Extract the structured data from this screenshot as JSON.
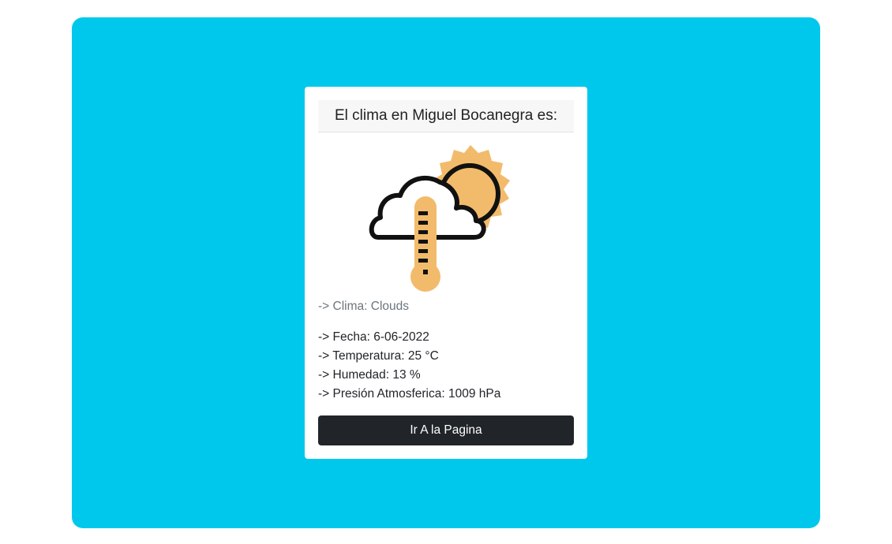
{
  "theme": {
    "panel_color": "#00c8ec",
    "button_color": "#212529",
    "icon_sun_color": "#f2bb6b",
    "icon_outline_color": "#111111"
  },
  "card": {
    "title": "El clima en Miguel Bocanegra es:",
    "icon": "cloud-sun-thermometer-icon",
    "weather_line": "-> Clima: Clouds",
    "details": [
      "-> Fecha: 6-06-2022",
      "-> Temperatura: 25 °C",
      "-> Humedad: 13 %",
      "-> Presión Atmosferica: 1009 hPa"
    ],
    "button_label": "Ir A la Pagina"
  }
}
